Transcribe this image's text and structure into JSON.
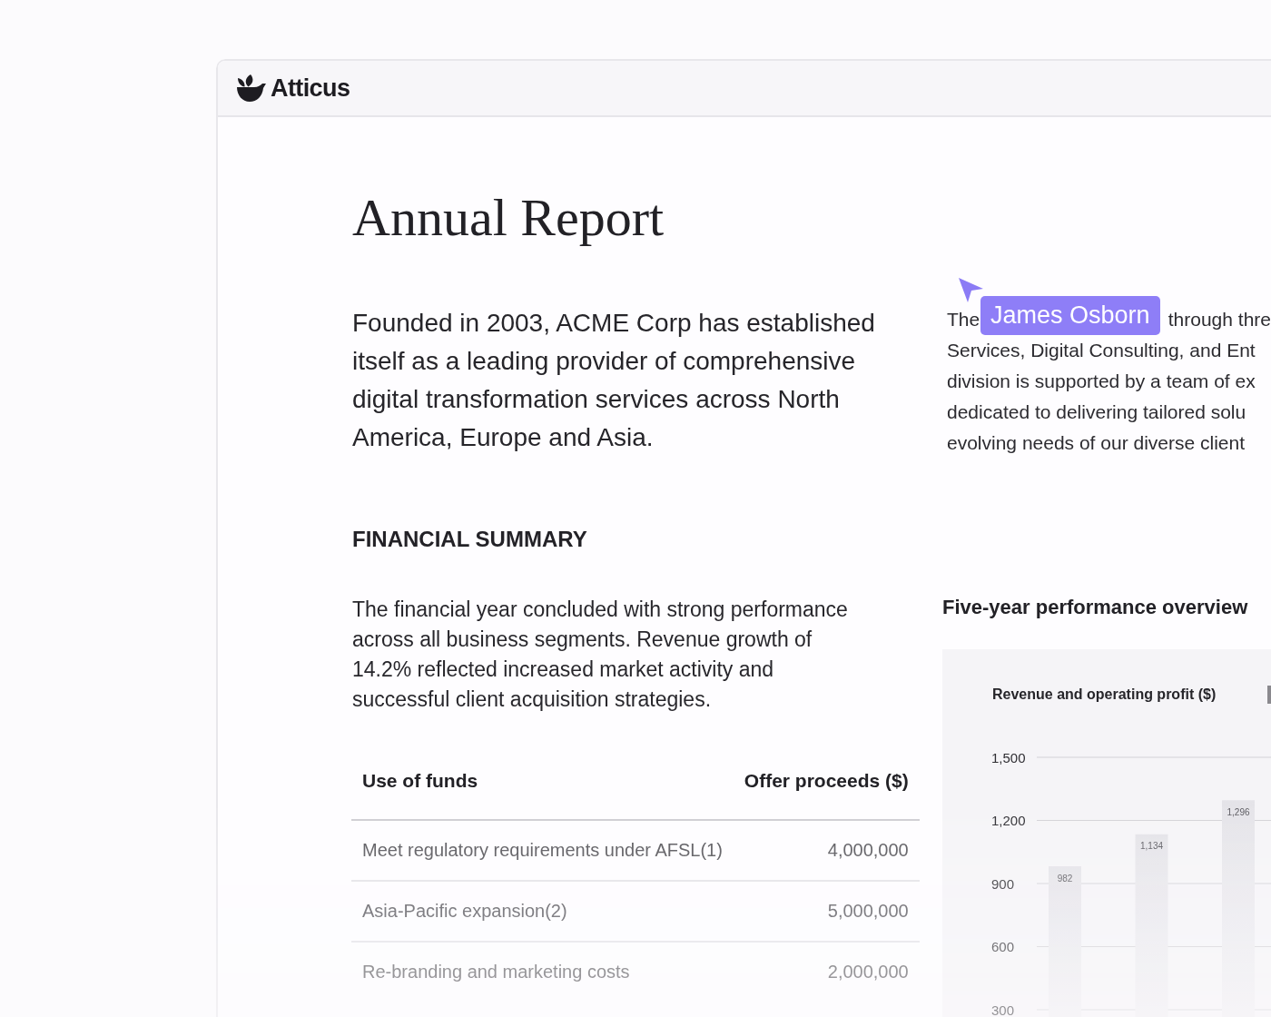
{
  "header": {
    "brand": "Atticus"
  },
  "document": {
    "title": "Annual Report",
    "intro": "Founded in 2003, ACME Corp has established itself as a leading provider of comprehensive digital transformation services across North America, Europe and Asia.",
    "side_text": {
      "first_line_start": "The",
      "first_line_end": "through thre",
      "lines": [
        "Services, Digital Consulting, and Ent",
        "division is supported by a team of ex",
        "dedicated to delivering tailored solu",
        "evolving needs of our diverse client"
      ]
    },
    "collaborator_cursor": {
      "name": "James Osborn"
    },
    "section_heading": "FINANCIAL SUMMARY",
    "summary": "The financial year concluded with strong performance across all business segments. Revenue growth of 14.2% reflected increased market activity and successful client acquisition strategies.",
    "table": {
      "columns": [
        "Use of funds",
        "Offer proceeds ($)"
      ],
      "rows": [
        [
          "Meet regulatory requirements under AFSL(1)",
          "4,000,000"
        ],
        [
          "Asia-Pacific expansion(2)",
          "5,000,000"
        ],
        [
          "Re-branding and marketing costs",
          "2,000,000"
        ]
      ]
    },
    "chart_panel": {
      "heading": "Five-year performance overview",
      "chart_data": {
        "type": "bar",
        "title": "Revenue and operating profit ($)",
        "values": [
          982,
          1134,
          1296
        ],
        "ylim": [
          300,
          1500
        ],
        "yticks": [
          {
            "value": 300,
            "label": "300"
          },
          {
            "value": 600,
            "label": "600"
          },
          {
            "value": 900,
            "label": "900"
          },
          {
            "value": 1200,
            "label": "1,200"
          },
          {
            "value": 1500,
            "label": "1,500"
          }
        ],
        "grid": true,
        "value_labels": [
          "982",
          "1,134",
          "1,296"
        ]
      }
    }
  }
}
